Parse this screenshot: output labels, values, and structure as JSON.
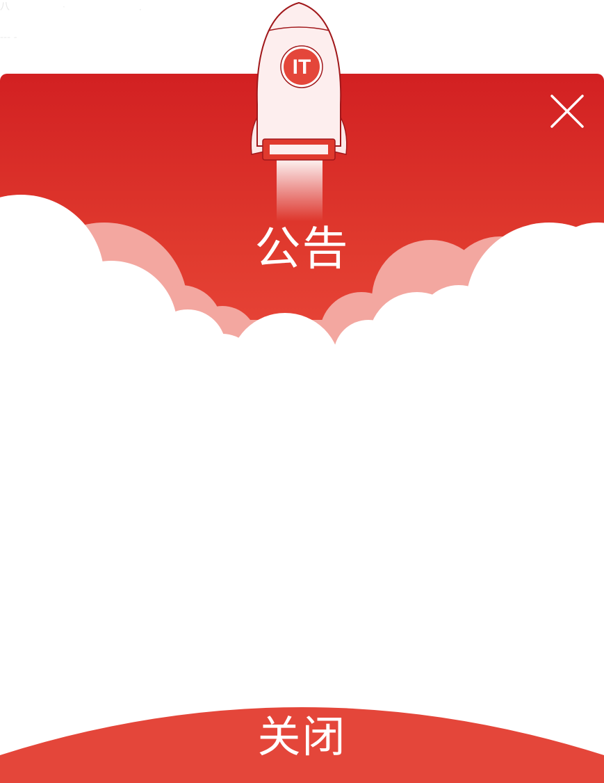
{
  "dialog": {
    "title": "公告",
    "close_button_label": "关闭",
    "badge_text": "IT"
  },
  "icons": {
    "close": "close-icon",
    "rocket": "rocket-illustration"
  },
  "colors": {
    "header_red": "#d22022",
    "header_red_light": "#e9473a",
    "footer_red": "#e4463a",
    "cloud_pink": "#f3a7a0",
    "white": "#ffffff"
  }
}
